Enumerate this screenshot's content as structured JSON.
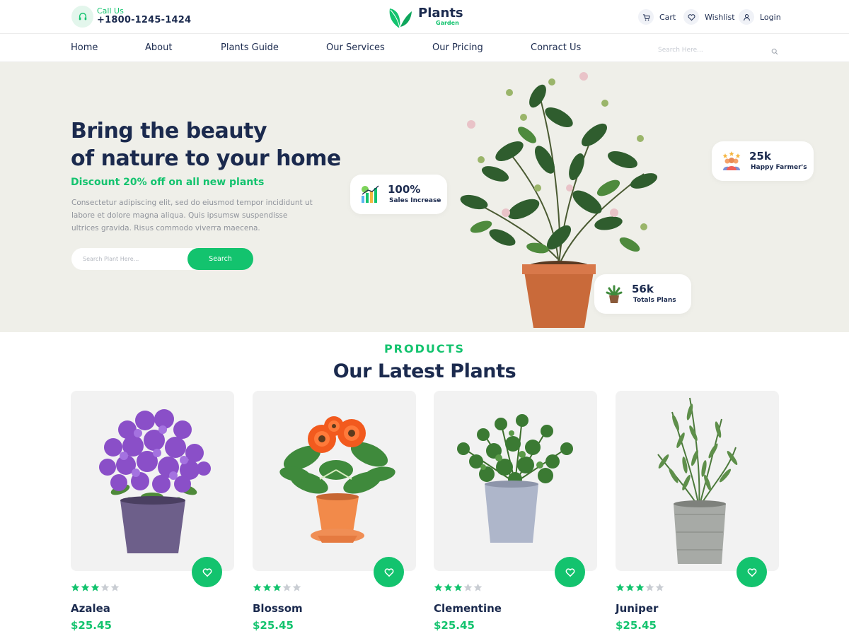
{
  "header": {
    "call_label": "Call Us",
    "phone": "+1800-1245-1424",
    "logo_name": "Plants",
    "logo_sub": "Garden",
    "cart_label": "Cart",
    "wishlist_label": "Wishlist",
    "login_label": "Login"
  },
  "nav": {
    "items": [
      {
        "label": "Home"
      },
      {
        "label": "About"
      },
      {
        "label": "Plants Guide"
      },
      {
        "label": "Our Services"
      },
      {
        "label": "Our Pricing"
      },
      {
        "label": "Conract Us"
      }
    ],
    "search_placeholder": "Search Here..."
  },
  "hero": {
    "title_line1": "Bring the beauty",
    "title_line2": "of nature to your home",
    "discount": "Discount 20% off on all new plants",
    "description": "Consectetur adipiscing elit, sed do eiusmod tempor incididunt ut labore et dolore magna aliqua. Quis ipsumsw suspendisse ultrices gravida. Risus commodo viverra maecena.",
    "search_placeholder": "Search Plant Here...",
    "search_button": "Search",
    "stats": {
      "sales": {
        "value": "100%",
        "label": "Sales Increase"
      },
      "farmers": {
        "value": "25k",
        "label": "Happy Farmer's"
      },
      "plans": {
        "value": "56k",
        "label": "Totals Plans"
      }
    }
  },
  "products": {
    "kicker": "PRODUCTS",
    "title": "Our Latest Plants",
    "items": [
      {
        "name": "Azalea",
        "price": "$25.45",
        "rating": 3,
        "max_rating": 5
      },
      {
        "name": "Blossom",
        "price": "$25.45",
        "rating": 3,
        "max_rating": 5
      },
      {
        "name": "Clementine",
        "price": "$25.45",
        "rating": 3,
        "max_rating": 5
      },
      {
        "name": "Juniper",
        "price": "$25.45",
        "rating": 3,
        "max_rating": 5
      }
    ]
  },
  "colors": {
    "accent": "#13c36e",
    "navy": "#1b2a4e",
    "hero_bg": "#efefe9",
    "star_on": "#13c36e",
    "star_off": "#c9cdd3"
  },
  "icons": {
    "call": "headset-icon",
    "cart": "cart-icon",
    "wishlist": "heart-icon",
    "login": "user-icon",
    "search": "search-icon",
    "favorite": "heart-icon"
  }
}
